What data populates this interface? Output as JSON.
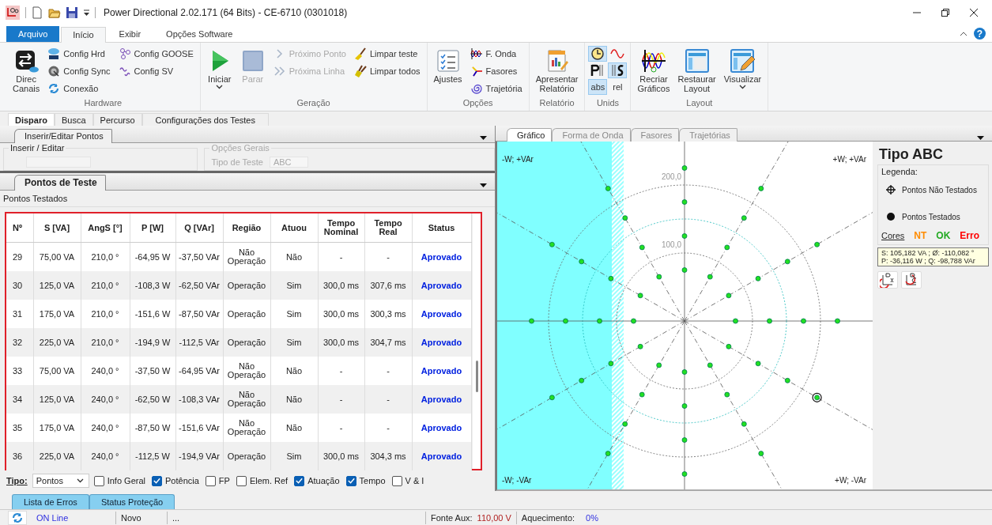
{
  "window": {
    "title": "Power Directional 2.02.171 (64 Bits) - CE-6710 (0301018)"
  },
  "ribbon_tabs": [
    {
      "label": "Arquivo",
      "kind": "file",
      "selected": false
    },
    {
      "label": "Início",
      "kind": "tab",
      "selected": true
    },
    {
      "label": "Exibir",
      "kind": "tab",
      "selected": false
    },
    {
      "label": "Opções Software",
      "kind": "tab",
      "selected": false
    }
  ],
  "help_button": "?",
  "ribbon": {
    "groups": [
      {
        "title": "Hardware",
        "columns": [
          {
            "kind": "large",
            "lines": [
              "Direc",
              "Canais"
            ],
            "disabled": false,
            "menu": false
          },
          {
            "kind": "stack",
            "items": [
              {
                "label": "Config Hrd",
                "disabled": false
              },
              {
                "label": "Config Sync",
                "disabled": false
              },
              {
                "label": "Conexão",
                "disabled": false
              }
            ]
          },
          {
            "kind": "stack",
            "items": [
              {
                "label": "Config GOOSE",
                "disabled": false
              },
              {
                "label": "Config SV",
                "disabled": false
              }
            ]
          }
        ]
      },
      {
        "title": "Geração",
        "columns": [
          {
            "kind": "large",
            "lines": [
              "Iniciar"
            ],
            "disabled": false,
            "menu": true
          },
          {
            "kind": "large",
            "lines": [
              "Parar"
            ],
            "disabled": true,
            "menu": false
          },
          {
            "kind": "stack",
            "items": [
              {
                "label": "Próximo Ponto",
                "disabled": true
              },
              {
                "label": "Próxima Linha",
                "disabled": true
              }
            ]
          },
          {
            "kind": "stack",
            "items": [
              {
                "label": "Limpar teste",
                "disabled": false
              },
              {
                "label": "Limpar todos",
                "disabled": false
              }
            ]
          }
        ]
      },
      {
        "title": "Opções",
        "columns": [
          {
            "kind": "large",
            "lines": [
              "Ajustes"
            ],
            "disabled": false,
            "menu": false
          },
          {
            "kind": "stack",
            "items": [
              {
                "label": "F. Onda",
                "disabled": false
              },
              {
                "label": "Fasores",
                "disabled": false
              },
              {
                "label": "Trajetória",
                "disabled": false
              }
            ]
          }
        ]
      },
      {
        "title": "Relatório",
        "columns": [
          {
            "kind": "large",
            "lines": [
              "Apresentar",
              "Relatório"
            ],
            "disabled": false,
            "menu": false
          }
        ]
      },
      {
        "title": "Unids",
        "columns": [
          {
            "kind": "toggles",
            "items": [
              {
                "kind": "clock",
                "selected": true
              },
              {
                "kind": "wave",
                "selected": false
              },
              {
                "kind": "p",
                "selected": false
              },
              {
                "kind": "s",
                "selected": true
              },
              {
                "kind": "text",
                "label": "abs",
                "selected": true
              },
              {
                "kind": "text",
                "label": "rel",
                "selected": false
              }
            ]
          }
        ]
      },
      {
        "title": "Layout",
        "columns": [
          {
            "kind": "large",
            "lines": [
              "Recriar",
              "Gráficos"
            ],
            "disabled": false,
            "menu": false
          },
          {
            "kind": "large",
            "lines": [
              "Restaurar",
              "Layout"
            ],
            "disabled": false,
            "menu": false
          },
          {
            "kind": "large",
            "lines": [
              "Visualizar"
            ],
            "disabled": false,
            "menu": true
          }
        ]
      }
    ]
  },
  "doc_tabs": [
    {
      "label": "Disparo",
      "selected": true
    },
    {
      "label": "Busca",
      "selected": false
    },
    {
      "label": "Percurso",
      "selected": false
    },
    {
      "label": "Configurações dos Testes",
      "selected": false
    }
  ],
  "insert_panel": {
    "tab": "Inserir/Editar Pontos",
    "group_insert": "Inserir / Editar",
    "group_options": "Opções Gerais",
    "test_type_label": "Tipo de Teste",
    "test_type_value": "ABC"
  },
  "points_panel": {
    "tab": "Pontos de Teste",
    "caption": "Pontos Testados"
  },
  "table": {
    "columns": [
      "Nº",
      "S [VA]",
      "AngS [°]",
      "P [W]",
      "Q [VAr]",
      "Região",
      "Atuou",
      "Tempo Nominal",
      "Tempo Real",
      "Status"
    ],
    "rows": [
      [
        "29",
        "75,00 VA",
        "210,0 °",
        "-64,95 W",
        "-37,50 VAr",
        "Não Operação",
        "Não",
        "-",
        "-",
        "Aprovado"
      ],
      [
        "30",
        "125,0 VA",
        "210,0 °",
        "-108,3 W",
        "-62,50 VAr",
        "Operação",
        "Sim",
        "300,0 ms",
        "307,6 ms",
        "Aprovado"
      ],
      [
        "31",
        "175,0 VA",
        "210,0 °",
        "-151,6 W",
        "-87,50 VAr",
        "Operação",
        "Sim",
        "300,0 ms",
        "300,3 ms",
        "Aprovado"
      ],
      [
        "32",
        "225,0 VA",
        "210,0 °",
        "-194,9 W",
        "-112,5 VAr",
        "Operação",
        "Sim",
        "300,0 ms",
        "304,7 ms",
        "Aprovado"
      ],
      [
        "33",
        "75,00 VA",
        "240,0 °",
        "-37,50 W",
        "-64,95 VAr",
        "Não Operação",
        "Não",
        "-",
        "-",
        "Aprovado"
      ],
      [
        "34",
        "125,0 VA",
        "240,0 °",
        "-62,50 W",
        "-108,3 VAr",
        "Não Operação",
        "Não",
        "-",
        "-",
        "Aprovado"
      ],
      [
        "35",
        "175,0 VA",
        "240,0 °",
        "-87,50 W",
        "-151,6 VAr",
        "Não Operação",
        "Não",
        "-",
        "-",
        "Aprovado"
      ],
      [
        "36",
        "225,0 VA",
        "240,0 °",
        "-112,5 W",
        "-194,9 VAr",
        "Operação",
        "Sim",
        "300,0 ms",
        "304,3 ms",
        "Aprovado"
      ]
    ]
  },
  "footer": {
    "type_label": "Tipo:",
    "type_value": "Pontos",
    "options": [
      {
        "label": "Info Geral",
        "checked": false
      },
      {
        "label": "Potência",
        "checked": true
      },
      {
        "label": "FP",
        "checked": false
      },
      {
        "label": "Elem. Ref",
        "checked": false
      },
      {
        "label": "Atuação",
        "checked": true
      },
      {
        "label": "Tempo",
        "checked": true
      },
      {
        "label": "V & I",
        "checked": false
      }
    ]
  },
  "chart_tabs": [
    {
      "label": "Gráfico",
      "selected": true
    },
    {
      "label": "Forma de Onda",
      "selected": false
    },
    {
      "label": "Fasores",
      "selected": false
    },
    {
      "label": "Trajetórias",
      "selected": false
    }
  ],
  "chart": {
    "quadrants": [
      "-W; +VAr",
      "+W; +VAr",
      "-W; -VAr",
      "+W; -VAr"
    ],
    "ring_labels": [
      "200,0",
      "100,0"
    ]
  },
  "legend": {
    "title": "Tipo ABC",
    "caption": "Legenda:",
    "entries": [
      {
        "kind": "untested",
        "label": "Pontos Não Testados"
      },
      {
        "kind": "tested",
        "label": "Pontos Testados"
      }
    ],
    "colors_label": "Cores",
    "colors": [
      {
        "label": "NT",
        "color": "#ff8c00"
      },
      {
        "label": "OK",
        "color": "#22aa22"
      },
      {
        "label": "Erro",
        "color": "#ff0000"
      }
    ]
  },
  "readout": [
    "S: 105,182 VA ; Ø: -110,082 °",
    "P: -36,116 W ; Q: -98,788 VAr"
  ],
  "bottom_tabs": [
    "Lista de Erros",
    "Status Proteção"
  ],
  "status_bar": {
    "connection": "ON Line",
    "file": "Novo",
    "message": "...",
    "aux_label": "Fonte Aux:",
    "aux_value": "110,00 V",
    "heat_label": "Aquecimento:",
    "heat_value": "0%"
  }
}
